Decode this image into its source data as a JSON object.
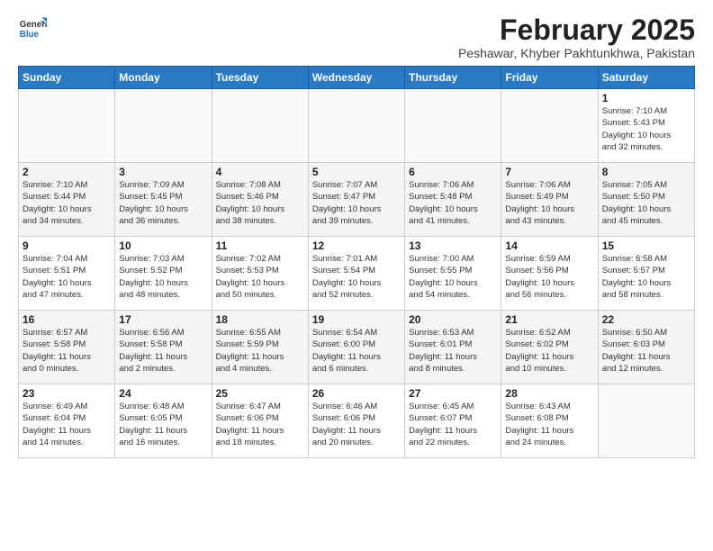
{
  "logo": {
    "line1": "General",
    "line2": "Blue"
  },
  "title": "February 2025",
  "subtitle": "Peshawar, Khyber Pakhtunkhwa, Pakistan",
  "days_of_week": [
    "Sunday",
    "Monday",
    "Tuesday",
    "Wednesday",
    "Thursday",
    "Friday",
    "Saturday"
  ],
  "weeks": [
    {
      "alt": false,
      "days": [
        {
          "num": "",
          "info": ""
        },
        {
          "num": "",
          "info": ""
        },
        {
          "num": "",
          "info": ""
        },
        {
          "num": "",
          "info": ""
        },
        {
          "num": "",
          "info": ""
        },
        {
          "num": "",
          "info": ""
        },
        {
          "num": "1",
          "info": "Sunrise: 7:10 AM\nSunset: 5:43 PM\nDaylight: 10 hours\nand 32 minutes."
        }
      ]
    },
    {
      "alt": true,
      "days": [
        {
          "num": "2",
          "info": "Sunrise: 7:10 AM\nSunset: 5:44 PM\nDaylight: 10 hours\nand 34 minutes."
        },
        {
          "num": "3",
          "info": "Sunrise: 7:09 AM\nSunset: 5:45 PM\nDaylight: 10 hours\nand 36 minutes."
        },
        {
          "num": "4",
          "info": "Sunrise: 7:08 AM\nSunset: 5:46 PM\nDaylight: 10 hours\nand 38 minutes."
        },
        {
          "num": "5",
          "info": "Sunrise: 7:07 AM\nSunset: 5:47 PM\nDaylight: 10 hours\nand 39 minutes."
        },
        {
          "num": "6",
          "info": "Sunrise: 7:06 AM\nSunset: 5:48 PM\nDaylight: 10 hours\nand 41 minutes."
        },
        {
          "num": "7",
          "info": "Sunrise: 7:06 AM\nSunset: 5:49 PM\nDaylight: 10 hours\nand 43 minutes."
        },
        {
          "num": "8",
          "info": "Sunrise: 7:05 AM\nSunset: 5:50 PM\nDaylight: 10 hours\nand 45 minutes."
        }
      ]
    },
    {
      "alt": false,
      "days": [
        {
          "num": "9",
          "info": "Sunrise: 7:04 AM\nSunset: 5:51 PM\nDaylight: 10 hours\nand 47 minutes."
        },
        {
          "num": "10",
          "info": "Sunrise: 7:03 AM\nSunset: 5:52 PM\nDaylight: 10 hours\nand 48 minutes."
        },
        {
          "num": "11",
          "info": "Sunrise: 7:02 AM\nSunset: 5:53 PM\nDaylight: 10 hours\nand 50 minutes."
        },
        {
          "num": "12",
          "info": "Sunrise: 7:01 AM\nSunset: 5:54 PM\nDaylight: 10 hours\nand 52 minutes."
        },
        {
          "num": "13",
          "info": "Sunrise: 7:00 AM\nSunset: 5:55 PM\nDaylight: 10 hours\nand 54 minutes."
        },
        {
          "num": "14",
          "info": "Sunrise: 6:59 AM\nSunset: 5:56 PM\nDaylight: 10 hours\nand 56 minutes."
        },
        {
          "num": "15",
          "info": "Sunrise: 6:58 AM\nSunset: 5:57 PM\nDaylight: 10 hours\nand 58 minutes."
        }
      ]
    },
    {
      "alt": true,
      "days": [
        {
          "num": "16",
          "info": "Sunrise: 6:57 AM\nSunset: 5:58 PM\nDaylight: 11 hours\nand 0 minutes."
        },
        {
          "num": "17",
          "info": "Sunrise: 6:56 AM\nSunset: 5:58 PM\nDaylight: 11 hours\nand 2 minutes."
        },
        {
          "num": "18",
          "info": "Sunrise: 6:55 AM\nSunset: 5:59 PM\nDaylight: 11 hours\nand 4 minutes."
        },
        {
          "num": "19",
          "info": "Sunrise: 6:54 AM\nSunset: 6:00 PM\nDaylight: 11 hours\nand 6 minutes."
        },
        {
          "num": "20",
          "info": "Sunrise: 6:53 AM\nSunset: 6:01 PM\nDaylight: 11 hours\nand 8 minutes."
        },
        {
          "num": "21",
          "info": "Sunrise: 6:52 AM\nSunset: 6:02 PM\nDaylight: 11 hours\nand 10 minutes."
        },
        {
          "num": "22",
          "info": "Sunrise: 6:50 AM\nSunset: 6:03 PM\nDaylight: 11 hours\nand 12 minutes."
        }
      ]
    },
    {
      "alt": false,
      "days": [
        {
          "num": "23",
          "info": "Sunrise: 6:49 AM\nSunset: 6:04 PM\nDaylight: 11 hours\nand 14 minutes."
        },
        {
          "num": "24",
          "info": "Sunrise: 6:48 AM\nSunset: 6:05 PM\nDaylight: 11 hours\nand 16 minutes."
        },
        {
          "num": "25",
          "info": "Sunrise: 6:47 AM\nSunset: 6:06 PM\nDaylight: 11 hours\nand 18 minutes."
        },
        {
          "num": "26",
          "info": "Sunrise: 6:46 AM\nSunset: 6:06 PM\nDaylight: 11 hours\nand 20 minutes."
        },
        {
          "num": "27",
          "info": "Sunrise: 6:45 AM\nSunset: 6:07 PM\nDaylight: 11 hours\nand 22 minutes."
        },
        {
          "num": "28",
          "info": "Sunrise: 6:43 AM\nSunset: 6:08 PM\nDaylight: 11 hours\nand 24 minutes."
        },
        {
          "num": "",
          "info": ""
        }
      ]
    }
  ]
}
